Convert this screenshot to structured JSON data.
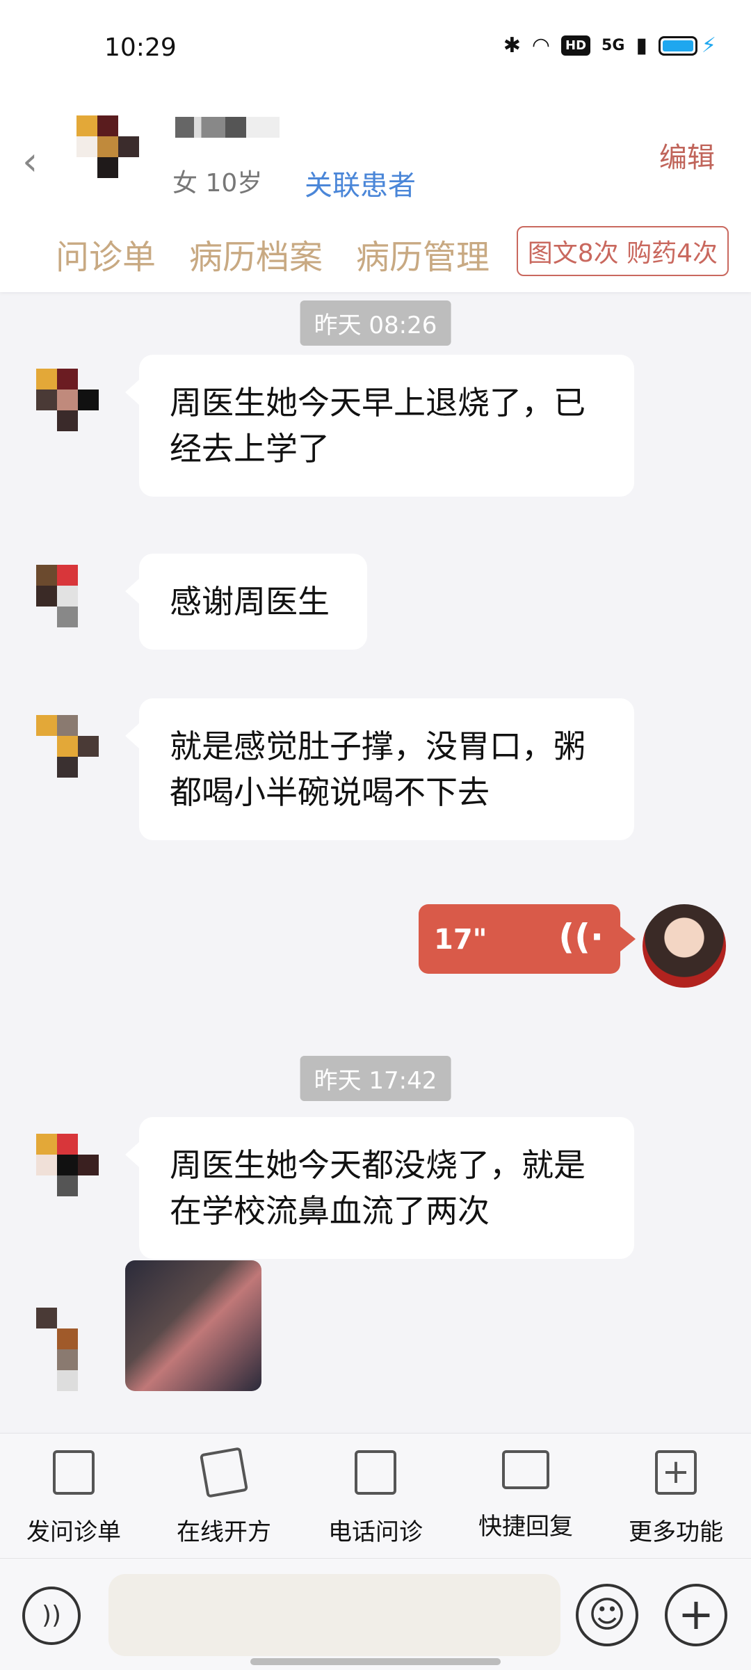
{
  "status_bar": {
    "time": "10:29",
    "icons": [
      "bluetooth-icon",
      "wifi-icon",
      "hd-icon",
      "signal-5g-icon",
      "battery-icon",
      "charging-icon"
    ],
    "hd_label": "HD",
    "network_label": "5G"
  },
  "header": {
    "patient_info": "女 10岁",
    "link_patient": "关联患者",
    "edit": "编辑",
    "tabs": [
      {
        "label": "问诊单"
      },
      {
        "label": "病历档案"
      },
      {
        "label": "病历管理"
      }
    ],
    "usage_badge": "图文8次 购药4次"
  },
  "chat": {
    "messages": [
      {
        "type": "timestamp",
        "text": "昨天 08:26"
      },
      {
        "type": "text",
        "from": "patient",
        "lines": [
          "周医生她今天早上退烧了，已",
          "经去上学了"
        ]
      },
      {
        "type": "text",
        "from": "patient",
        "lines": [
          "感谢周医生"
        ]
      },
      {
        "type": "text",
        "from": "patient",
        "lines": [
          "就是感觉肚子撑，没胃口，粥",
          "都喝小半碗说喝不下去"
        ]
      },
      {
        "type": "voice",
        "from": "doctor",
        "duration": "17\""
      },
      {
        "type": "timestamp",
        "text": "昨天 17:42"
      },
      {
        "type": "text",
        "from": "patient",
        "lines": [
          "周医生她今天都没烧了，就是",
          "在学校流鼻血流了两次"
        ]
      },
      {
        "type": "image",
        "from": "patient"
      }
    ]
  },
  "toolbar": {
    "items": [
      {
        "label": "发问诊单",
        "icon": "form-icon"
      },
      {
        "label": "在线开方",
        "icon": "prescription-icon"
      },
      {
        "label": "电话问诊",
        "icon": "phone-icon"
      },
      {
        "label": "快捷回复",
        "icon": "quick-reply-icon"
      },
      {
        "label": "更多功能",
        "icon": "more-plus-icon"
      }
    ]
  },
  "input_bar": {
    "placeholder": "",
    "icons": [
      "voice-input-icon",
      "emoji-icon",
      "plus-icon"
    ]
  },
  "colors": {
    "accent_red": "#d95a49",
    "tab_gold": "#c8a982",
    "link_blue": "#4a86d8",
    "edit_red": "#c0645a"
  }
}
